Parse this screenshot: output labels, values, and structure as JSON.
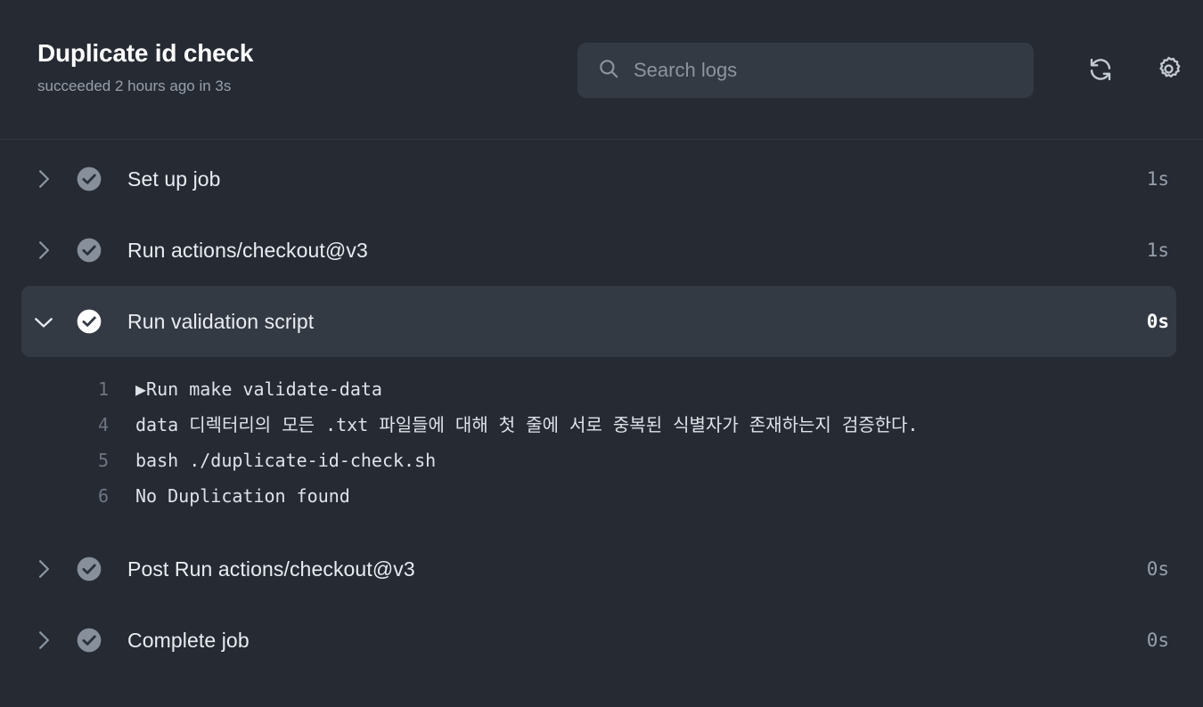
{
  "header": {
    "title": "Duplicate id check",
    "status": "succeeded 2 hours ago in 3s",
    "search": {
      "placeholder": "Search logs",
      "value": "",
      "icon": "search-icon"
    },
    "actions": [
      {
        "icon": "refresh-icon",
        "label": "Refresh"
      },
      {
        "icon": "gear-icon",
        "label": "Settings"
      }
    ]
  },
  "colors": {
    "page_background": "#252a33",
    "row_active_background": "#343a44",
    "search_background": "#343a44",
    "text_primary": "#e9ecf1",
    "text_muted": "#97a0ab",
    "status_check_muted": "#868f9a",
    "status_check_active": "#ffffff",
    "divider": "#333943"
  },
  "steps": [
    {
      "id": "set-up-job",
      "label": "Set up job",
      "duration": "1s",
      "status": "succeeded",
      "expanded": false,
      "chevron": "chevron-right-icon"
    },
    {
      "id": "run-actions-checkout-v3",
      "label": "Run actions/checkout@v3",
      "duration": "1s",
      "status": "succeeded",
      "expanded": false,
      "chevron": "chevron-right-icon"
    },
    {
      "id": "run-validation-script",
      "label": "Run validation script",
      "duration": "0s",
      "status": "succeeded",
      "expanded": true,
      "chevron": "chevron-down-icon",
      "log": [
        {
          "lineno": "1",
          "marker": "▶",
          "text": "Run make validate-data"
        },
        {
          "lineno": "4",
          "marker": "",
          "text": "data 디렉터리의 모든 .txt 파일들에 대해 첫 줄에 서로 중복된 식별자가 존재하는지 검증한다."
        },
        {
          "lineno": "5",
          "marker": "",
          "text": "bash ./duplicate-id-check.sh"
        },
        {
          "lineno": "6",
          "marker": "",
          "text": "No Duplication found"
        }
      ]
    },
    {
      "id": "post-run-actions-checkout-v3",
      "label": "Post Run actions/checkout@v3",
      "duration": "0s",
      "status": "succeeded",
      "expanded": false,
      "chevron": "chevron-right-icon"
    },
    {
      "id": "complete-job",
      "label": "Complete job",
      "duration": "0s",
      "status": "succeeded",
      "expanded": false,
      "chevron": "chevron-right-icon"
    }
  ]
}
